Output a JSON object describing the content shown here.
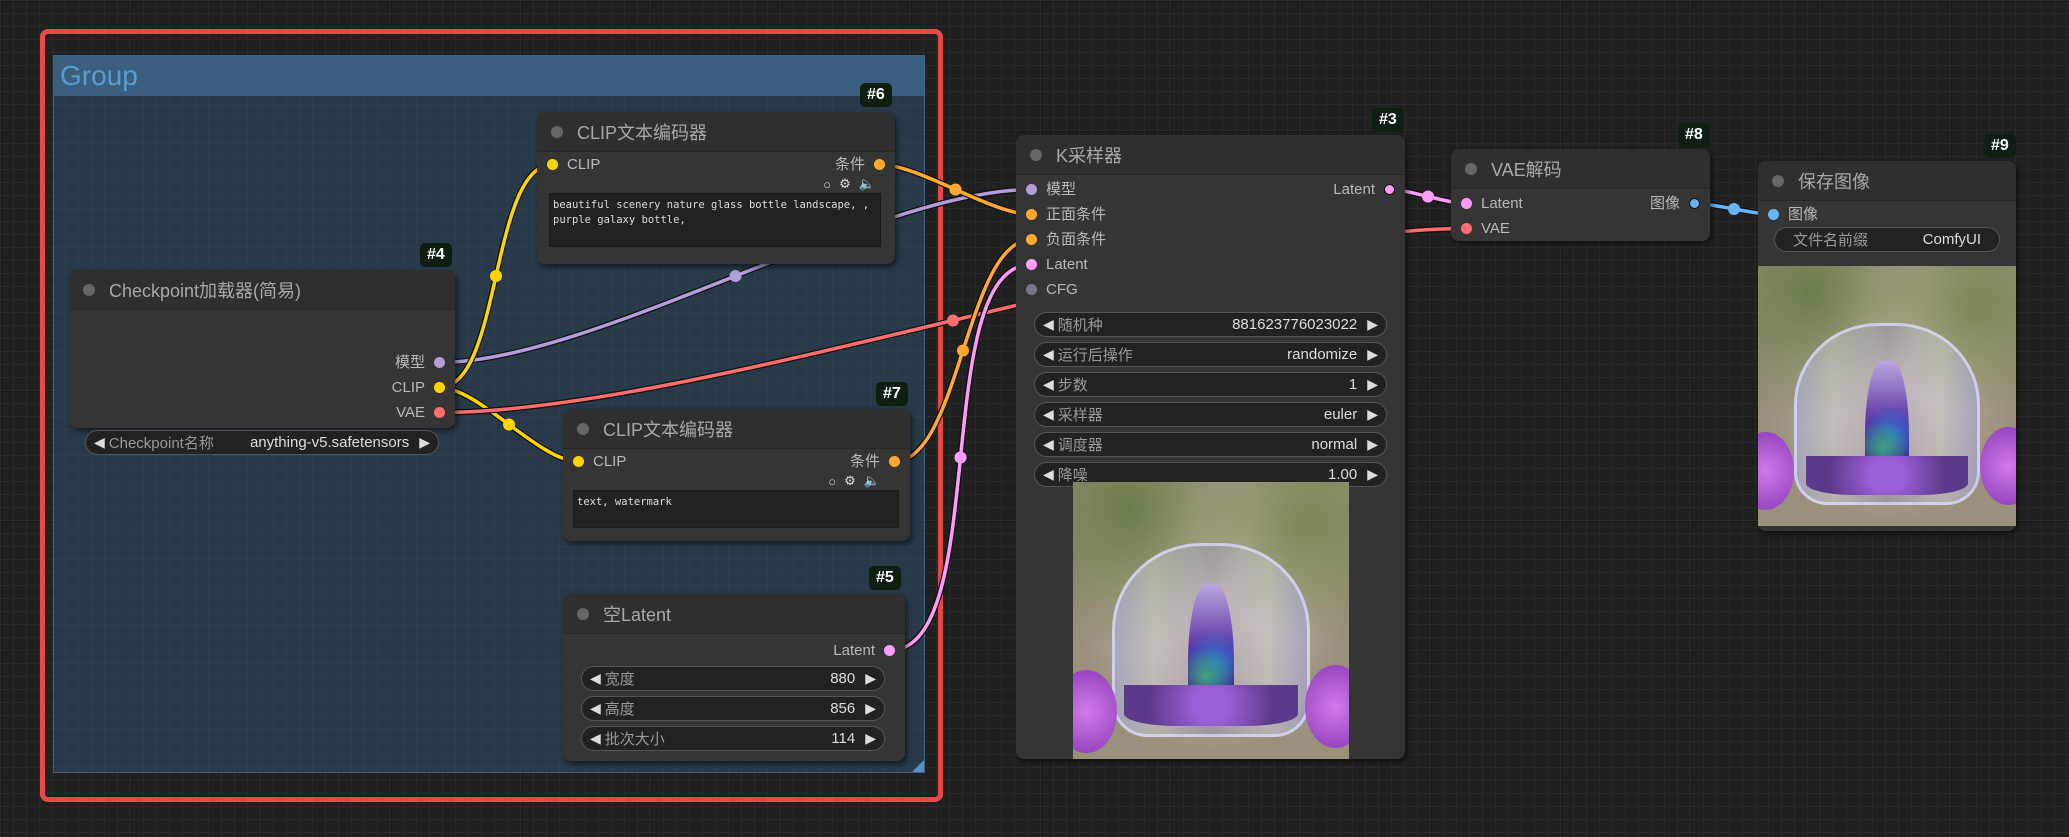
{
  "group": {
    "title": "Group"
  },
  "nodes": {
    "checkpoint": {
      "id": "#4",
      "title": "Checkpoint加载器(简易)",
      "outputs": [
        "模型",
        "CLIP",
        "VAE"
      ],
      "widget": {
        "label": "Checkpoint名称",
        "value": "anything-v5.safetensors"
      }
    },
    "clip_pos": {
      "id": "#6",
      "title": "CLIP文本编码器",
      "input": "CLIP",
      "output": "条件",
      "text": "beautiful scenery nature glass bottle landscape, , purple galaxy bottle,"
    },
    "clip_neg": {
      "id": "#7",
      "title": "CLIP文本编码器",
      "input": "CLIP",
      "output": "条件",
      "text": "text, watermark"
    },
    "latent": {
      "id": "#5",
      "title": "空Latent",
      "output": "Latent",
      "widgets": [
        {
          "label": "宽度",
          "value": "880"
        },
        {
          "label": "高度",
          "value": "856"
        },
        {
          "label": "批次大小",
          "value": "114"
        }
      ]
    },
    "ksampler": {
      "id": "#3",
      "title": "K采样器",
      "inputs": [
        "模型",
        "正面条件",
        "负面条件",
        "Latent",
        "CFG"
      ],
      "output": "Latent",
      "widgets": [
        {
          "label": "随机种",
          "value": "881623776023022"
        },
        {
          "label": "运行后操作",
          "value": "randomize"
        },
        {
          "label": "步数",
          "value": "1"
        },
        {
          "label": "采样器",
          "value": "euler"
        },
        {
          "label": "调度器",
          "value": "normal"
        },
        {
          "label": "降噪",
          "value": "1.00"
        }
      ]
    },
    "vae": {
      "id": "#8",
      "title": "VAE解码",
      "inputs": [
        "Latent",
        "VAE"
      ],
      "output": "图像"
    },
    "save": {
      "id": "#9",
      "title": "保存图像",
      "input": "图像",
      "widget": {
        "label": "文件名前缀",
        "value": "ComfyUI"
      }
    }
  },
  "colors": {
    "model": "#b39ddb",
    "clip": "#ffd500",
    "vae": "#ff6e6e",
    "cond": "#ffa931",
    "latent": "#ff9cf9",
    "image": "#64b5f6",
    "cfg": "#77778a",
    "selection": "#e64a48"
  }
}
